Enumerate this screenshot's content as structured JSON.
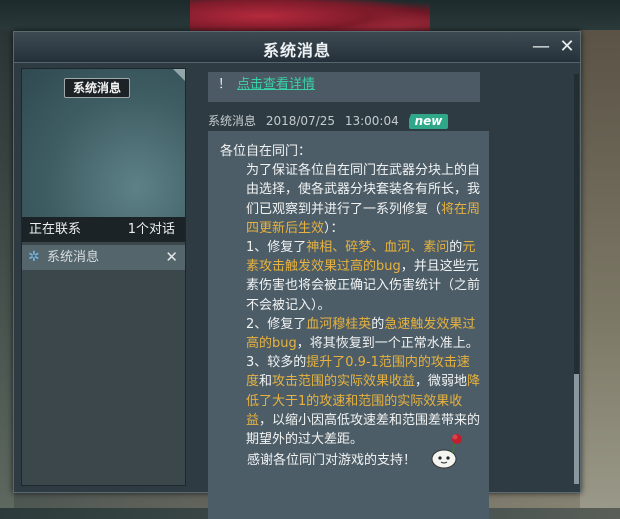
{
  "window": {
    "title": "系统消息",
    "minimize_icon": "minus-icon",
    "close_icon": "close-icon"
  },
  "sidebar": {
    "banner_label": "系统消息",
    "contact_label": "正在联系",
    "contact_count": "1个对话",
    "conversations": [
      {
        "label": "系统消息",
        "icon": "gear-icon"
      }
    ]
  },
  "previous_message": {
    "prefix": "！",
    "link": "点击查看详情"
  },
  "message": {
    "sender": "系统消息",
    "date": "2018/07/25",
    "time": "13:00:04",
    "badge": "new",
    "greeting": "各位自在同门：",
    "para1_a": "为了保证各位自在同门在武器分块上的自由选择，使各武器分块套装各有所长，我们已观察到并进行了一系列修复（",
    "para1_hl": "将在周四更新后生效",
    "para1_b": "）：",
    "fix1_a": "1、修复了",
    "fix1_hl1": "神相、碎梦、血河、素问",
    "fix1_b": "的",
    "fix1_hl2": "元素攻击触发效果过高的bug",
    "fix1_c": "，并且这些元素伤害也将会被正确记入伤害统计（之前不会被记入）。",
    "fix2_a": "2、修复了",
    "fix2_hl1": "血河穆桂英",
    "fix2_b": "的",
    "fix2_hl2": "急速触发效果过高的bug",
    "fix2_c": "，将其恢复到一个正常水准上。",
    "fix3_a": "3、较多的",
    "fix3_hl1": "提升了0.9-1范围内的攻击速度",
    "fix3_b": "和",
    "fix3_hl2": "攻击范围的实际效果收益",
    "fix3_c": "，微弱地",
    "fix3_hl3": "降低了大于1的攻速和范围的实际效果收益",
    "fix3_d": "，以缩小因高低攻速差和范围差带来的期望外的过大差距。",
    "thanks": "感谢各位同门对游戏的支持！"
  },
  "colors": {
    "highlight": "#e7b23f",
    "link": "#3ad1a8",
    "badge": "#2fa889"
  }
}
